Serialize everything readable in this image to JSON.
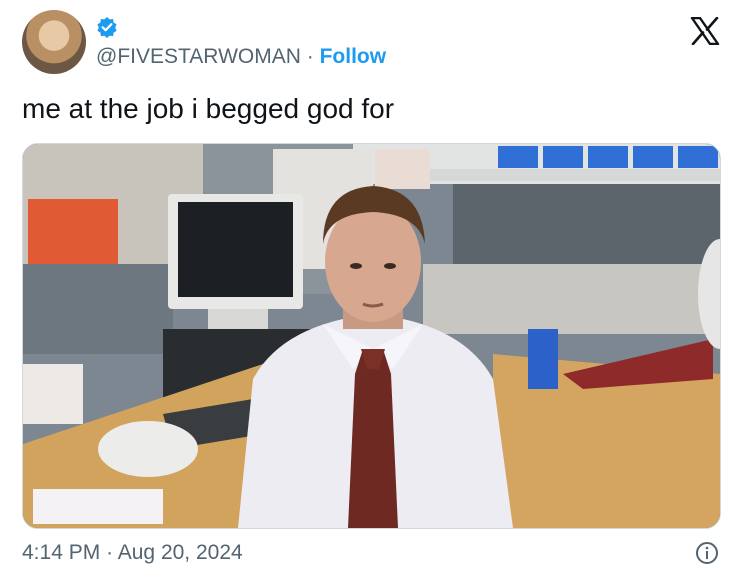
{
  "author": {
    "handle": "@FIVESTARWOMAN",
    "separator": "·",
    "follow_label": "Follow",
    "verified_icon": "verified-badge-icon",
    "avatar_icon": "profile-avatar"
  },
  "brand": {
    "logo_icon": "x-logo-icon"
  },
  "tweet": {
    "text": "me at the job i begged god for"
  },
  "media": {
    "description_icon": "office-worker-photo"
  },
  "footer": {
    "time": "4:14 PM",
    "separator": "·",
    "date": "Aug 20, 2024",
    "info_icon": "info-icon"
  },
  "colors": {
    "accent": "#1d9bf0",
    "text": "#0f1419",
    "secondary": "#536471"
  }
}
